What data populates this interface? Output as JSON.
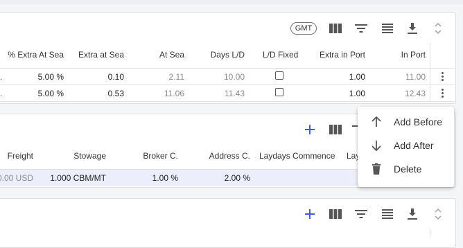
{
  "panel1": {
    "timezone_chip": "GMT",
    "headers": [
      "% Extra At Sea",
      "Extra at Sea",
      "At Sea",
      "Days L/D",
      "L/D Fixed",
      "Extra in Port",
      "In Port"
    ],
    "rows": [
      {
        "pct_extra_at_sea": "5.00 %",
        "extra_at_sea": "0.10",
        "at_sea": "2.11",
        "days_ld": "10.00",
        "ld_fixed": false,
        "extra_in_port": "1.00",
        "in_port": "11.00"
      },
      {
        "pct_extra_at_sea": "5.00 %",
        "extra_at_sea": "0.53",
        "at_sea": "11.06",
        "days_ld": "11.43",
        "ld_fixed": false,
        "extra_in_port": "1.00",
        "in_port": "12.43"
      }
    ]
  },
  "panel2": {
    "headers": [
      "Freight",
      "Stowage",
      "Broker C.",
      "Address C.",
      "Laydays Commence",
      "Lay"
    ],
    "row": {
      "freight": "0.00 USD",
      "stowage": "1.000 CBM/MT",
      "broker_c": "1.00 %",
      "address_c": "2.00 %"
    }
  },
  "context_menu": {
    "items": [
      {
        "label": "Add Before",
        "icon": "arrow-up-icon"
      },
      {
        "label": "Add After",
        "icon": "arrow-down-icon"
      },
      {
        "label": "Delete",
        "icon": "trash-icon"
      }
    ]
  },
  "colors": {
    "accent": "#3d5afe",
    "icon": "#555555",
    "row_highlight": "#eceefb"
  }
}
